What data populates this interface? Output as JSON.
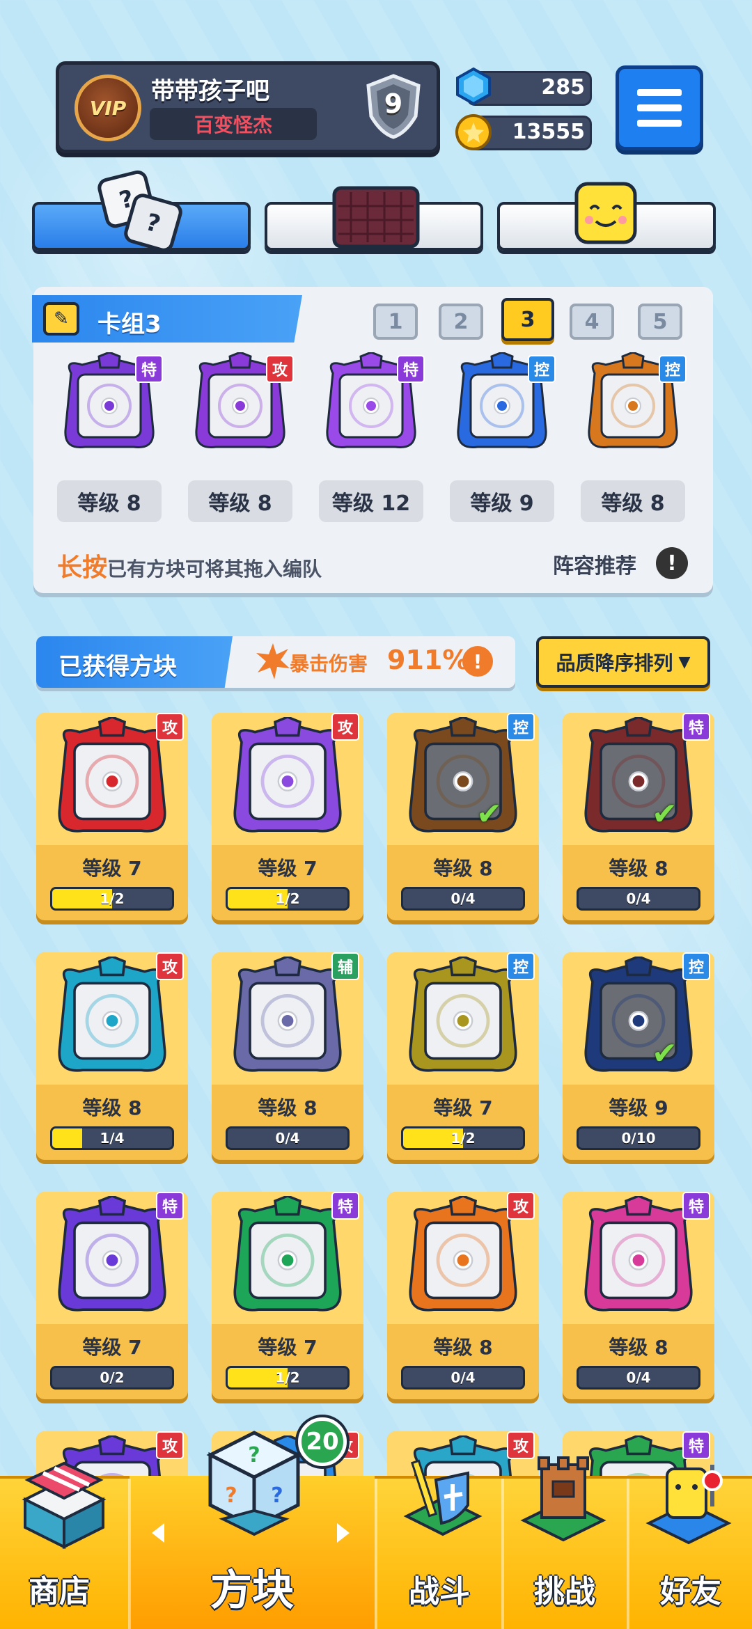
{
  "profile": {
    "vip_label": "VIP",
    "name": "带带孩子吧",
    "title": "百变怪杰",
    "rank": "9"
  },
  "currency": {
    "gems": "285",
    "coins": "13555"
  },
  "deck": {
    "title": "卡组3",
    "numbers": [
      "1",
      "2",
      "3",
      "4",
      "5"
    ],
    "active_index": 2,
    "cards": [
      {
        "tag": "特",
        "tag_type": "spe",
        "color": "#7a3ad8",
        "level": "等级 8"
      },
      {
        "tag": "攻",
        "tag_type": "atk",
        "color": "#8a3ad8",
        "level": "等级 8"
      },
      {
        "tag": "特",
        "tag_type": "spe",
        "color": "#9a4ae8",
        "level": "等级 12"
      },
      {
        "tag": "控",
        "tag_type": "ctl",
        "color": "#2a6ae0",
        "level": "等级 9"
      },
      {
        "tag": "控",
        "tag_type": "ctl",
        "color": "#d8781e",
        "level": "等级 8"
      }
    ],
    "tip_highlight": "长按",
    "tip_text": "已有方块可将其拖入编队",
    "recommend_label": "阵容推荐",
    "info_symbol": "!"
  },
  "obtained": {
    "title": "已获得方块",
    "crit_label": "暴击伤害",
    "crit_value": "911%",
    "crit_info": "!",
    "sort_label": "品质降序排列",
    "sort_arrow": "▼"
  },
  "grid": [
    {
      "tag": "攻",
      "tag_type": "atk",
      "color": "#d8282e",
      "level": "等级 7",
      "progress": "1/2",
      "fill": 0.5,
      "check": false,
      "dim": false
    },
    {
      "tag": "攻",
      "tag_type": "atk",
      "color": "#8a4ae0",
      "level": "等级 7",
      "progress": "1/2",
      "fill": 0.5,
      "check": false,
      "dim": false
    },
    {
      "tag": "控",
      "tag_type": "ctl",
      "color": "#7a4a1e",
      "level": "等级 8",
      "progress": "0/4",
      "fill": 0,
      "check": true,
      "dim": true
    },
    {
      "tag": "特",
      "tag_type": "spe",
      "color": "#7a2a2a",
      "level": "等级 8",
      "progress": "0/4",
      "fill": 0,
      "check": true,
      "dim": true
    },
    {
      "tag": "攻",
      "tag_type": "atk",
      "color": "#1ea6c8",
      "level": "等级 8",
      "progress": "1/4",
      "fill": 0.25,
      "check": false,
      "dim": false
    },
    {
      "tag": "辅",
      "tag_type": "sup",
      "color": "#6a6aa8",
      "level": "等级 8",
      "progress": "0/4",
      "fill": 0,
      "check": false,
      "dim": false
    },
    {
      "tag": "控",
      "tag_type": "ctl",
      "color": "#a8961e",
      "level": "等级 7",
      "progress": "1/2",
      "fill": 0.5,
      "check": false,
      "dim": false
    },
    {
      "tag": "控",
      "tag_type": "ctl",
      "color": "#1e3a7a",
      "level": "等级 9",
      "progress": "0/10",
      "fill": 0,
      "check": true,
      "dim": true
    },
    {
      "tag": "特",
      "tag_type": "spe",
      "color": "#6a3ad8",
      "level": "等级 7",
      "progress": "0/2",
      "fill": 0,
      "check": false,
      "dim": false
    },
    {
      "tag": "特",
      "tag_type": "spe",
      "color": "#1ea658",
      "level": "等级 7",
      "progress": "1/2",
      "fill": 0.5,
      "check": false,
      "dim": false
    },
    {
      "tag": "攻",
      "tag_type": "atk",
      "color": "#e8741e",
      "level": "等级 8",
      "progress": "0/4",
      "fill": 0,
      "check": false,
      "dim": false
    },
    {
      "tag": "特",
      "tag_type": "spe",
      "color": "#d83a9a",
      "level": "等级 8",
      "progress": "0/4",
      "fill": 0,
      "check": false,
      "dim": false
    },
    {
      "tag": "攻",
      "tag_type": "atk",
      "color": "#6a3ad8",
      "level": "",
      "progress": "",
      "fill": 0,
      "check": false,
      "dim": false
    },
    {
      "tag": "攻",
      "tag_type": "atk",
      "color": "#2a8ae8",
      "level": "",
      "progress": "",
      "fill": 0,
      "check": false,
      "dim": false
    },
    {
      "tag": "攻",
      "tag_type": "atk",
      "color": "#2aa6c8",
      "level": "",
      "progress": "",
      "fill": 0,
      "check": false,
      "dim": false
    },
    {
      "tag": "特",
      "tag_type": "spe",
      "color": "#2aa650",
      "level": "",
      "progress": "",
      "fill": 0,
      "check": false,
      "dim": false
    }
  ],
  "nav": {
    "shop": "商店",
    "blocks": "方块",
    "battle": "战斗",
    "challenge": "挑战",
    "friends": "好友",
    "blocks_badge": "20"
  },
  "colors": {
    "accent_blue": "#2b86ee",
    "accent_yellow": "#ffd23a",
    "highlight_orange": "#f07b2a"
  }
}
